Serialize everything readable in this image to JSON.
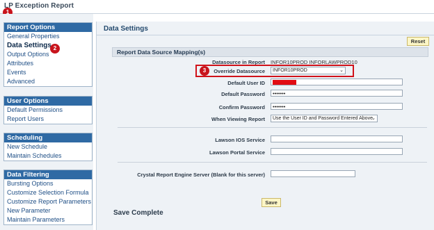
{
  "app": {
    "title": "LP Exception Report"
  },
  "markers": [
    "1",
    "2",
    "3"
  ],
  "report_options": {
    "header": "Report Options",
    "items": [
      "General Properties",
      "Data Settings",
      "Output Options",
      "Attributes",
      "Events",
      "Advanced"
    ]
  },
  "user_options": {
    "header": "User Options",
    "items": [
      "Default Permissions",
      "Report Users"
    ]
  },
  "scheduling": {
    "header": "Scheduling",
    "items": [
      "New Schedule",
      "Maintain Schedules"
    ]
  },
  "data_filtering": {
    "header": "Data Filtering",
    "items": [
      "Bursting Options",
      "Customize Selection Formula",
      "Customize Report Parameters",
      "New Parameter",
      "Maintain Parameters"
    ]
  },
  "main": {
    "title": "Data Settings",
    "reset_label": "Reset",
    "section_title": "Report Data Source Mapping(s)",
    "datasource_label": "Datasource in Report",
    "datasource_value": "INFOR10PROD INFORLAWPROD10",
    "override_label": "Override Datasource",
    "override_value": "INFOR10PROD",
    "user_id_label": "Default User ID",
    "password_label": "Default Password",
    "password_value": "•••••••",
    "confirm_label": "Confirm Password",
    "confirm_value": "•••••••",
    "when_viewing_label": "When Viewing Report",
    "when_viewing_value": "Use the User ID and Password Entered Above",
    "ios_label": "Lawson IOS Service",
    "portal_label": "Lawson Portal Service",
    "crystal_label": "Crystal Report Engine Server (Blank for this server)",
    "save_label": "Save",
    "status": "Save Complete"
  },
  "colors": {
    "panel_header": "#2f6aa4",
    "highlight": "#d0121a",
    "marker": "#c8141c",
    "button": "#fcf6c6"
  }
}
